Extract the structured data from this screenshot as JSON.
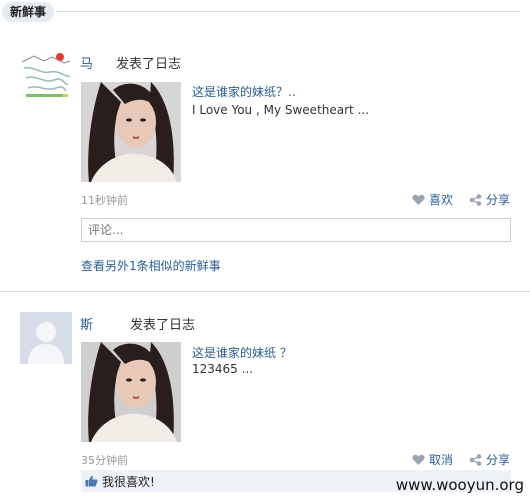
{
  "section_title": "新鲜事",
  "feed": [
    {
      "author": "马",
      "action": "发表了日志",
      "post_title": "这是谁家的妹纸？..",
      "post_excerpt": "I Love You , My Sweetheart ...",
      "timestamp": "11秒钟前",
      "like_label": "喜欢",
      "share_label": "分享",
      "comment_placeholder": "评论...",
      "more_link": "查看另外1条相似的新鲜事"
    },
    {
      "author": "斯",
      "action": "发表了日志",
      "post_title": "这是谁家的妹纸 ？",
      "post_excerpt": "123465 ...",
      "timestamp": "35分钟前",
      "like_label": "取消",
      "share_label": "分享",
      "liked_text": "我很喜欢!"
    }
  ],
  "watermark": "www.wooyun.org",
  "colors": {
    "link": "#2a5e96",
    "muted": "#999999",
    "header_bg": "#e6ebf2"
  },
  "icons": [
    "heart-icon",
    "share-icon",
    "thumbs-up-icon"
  ]
}
